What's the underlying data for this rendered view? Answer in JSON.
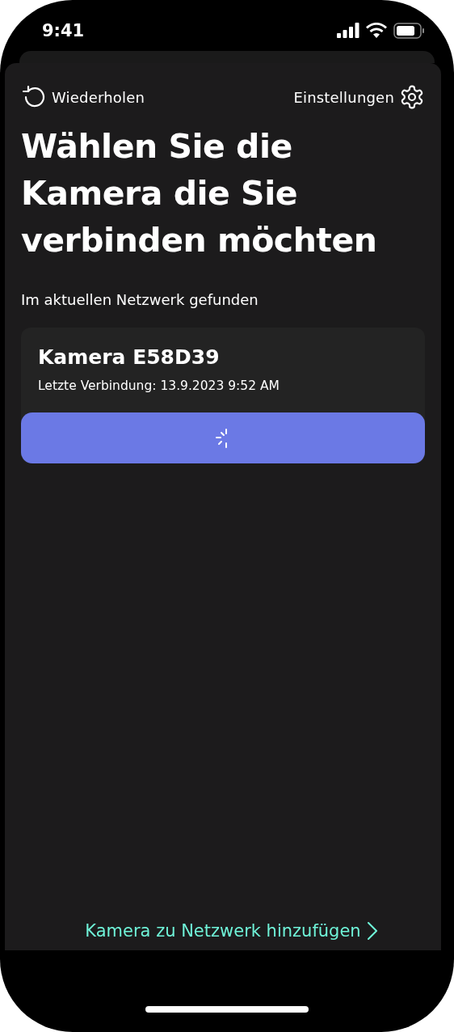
{
  "status_bar": {
    "time": "9:41"
  },
  "toolbar": {
    "retry": "Wiederholen",
    "settings": "Einstellungen"
  },
  "title": "Wählen Sie die Kamera die Sie verbinden möchten",
  "section_label": "Im aktuellen Netzwerk gefunden",
  "cameras": [
    {
      "name": "Kamera E58D39",
      "last_connection": "Letzte Verbindung: 13.9.2023 9:52 AM",
      "loading": true
    }
  ],
  "add_link": "Kamera zu Netzwerk hinzufügen"
}
